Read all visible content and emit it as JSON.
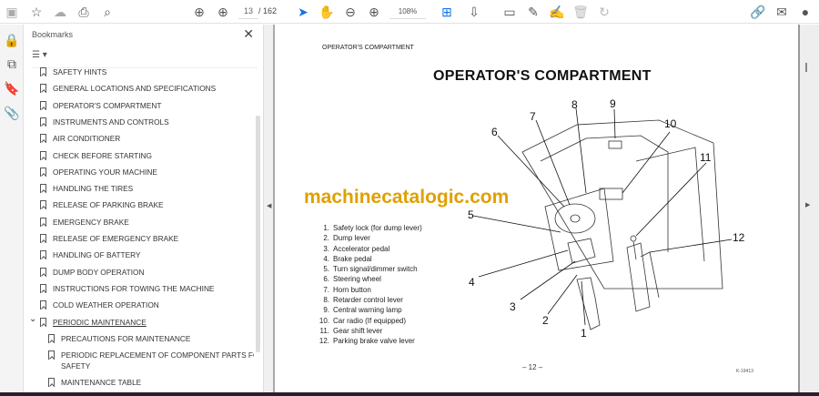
{
  "toolbar": {
    "current_page": "13",
    "total_pages": "/ 162",
    "zoom": "108%"
  },
  "bookmarks_panel": {
    "title": "Bookmarks",
    "close": "✕",
    "options": "☰ ▾",
    "items": [
      {
        "label": "SAFETY HINTS",
        "level": 0
      },
      {
        "label": "GENERAL LOCATIONS AND SPECIFICATIONS",
        "level": 0
      },
      {
        "label": "OPERATOR'S COMPARTMENT",
        "level": 0
      },
      {
        "label": "INSTRUMENTS AND CONTROLS",
        "level": 0
      },
      {
        "label": "AIR CONDITIONER",
        "level": 0
      },
      {
        "label": "CHECK BEFORE STARTING",
        "level": 0
      },
      {
        "label": "OPERATING YOUR MACHINE",
        "level": 0
      },
      {
        "label": "HANDLING THE TIRES",
        "level": 0
      },
      {
        "label": "RELEASE OF PARKING BRAKE",
        "level": 0
      },
      {
        "label": "EMERGENCY BRAKE",
        "level": 0
      },
      {
        "label": "RELEASE OF EMERGENCY BRAKE",
        "level": 0
      },
      {
        "label": "HANDLING OF BATTERY",
        "level": 0
      },
      {
        "label": "DUMP BODY OPERATION",
        "level": 0
      },
      {
        "label": "INSTRUCTIONS FOR TOWING THE MACHINE",
        "level": 0
      },
      {
        "label": "COLD WEATHER OPERATION",
        "level": 0
      },
      {
        "label": "PERIODIC MAINTENANCE",
        "level": 0
      },
      {
        "label": "PRECAUTIONS FOR MAINTENANCE",
        "level": 1
      },
      {
        "label": "PERIODIC REPLACEMENT OF COMPONENT PARTS FOR",
        "label2": "SAFETY",
        "level": 1
      },
      {
        "label": "MAINTENANCE TABLE",
        "level": 1
      }
    ]
  },
  "document": {
    "header": "OPERATOR'S COMPARTMENT",
    "title": "OPERATOR'S COMPARTMENT",
    "watermark": "machinecatalogic.com",
    "parts": [
      {
        "n": "1.",
        "t": "Safety lock (for dump lever)"
      },
      {
        "n": "2.",
        "t": "Dump lever"
      },
      {
        "n": "3.",
        "t": "Accelerator pedal"
      },
      {
        "n": "4.",
        "t": "Brake pedal"
      },
      {
        "n": "5.",
        "t": "Turn signal/dimmer switch"
      },
      {
        "n": "6.",
        "t": "Steering wheel"
      },
      {
        "n": "7.",
        "t": "Horn button"
      },
      {
        "n": "8.",
        "t": "Retarder control lever"
      },
      {
        "n": "9.",
        "t": "Central warning lamp"
      },
      {
        "n": "10.",
        "t": "Car radio (If equipped)"
      },
      {
        "n": "11.",
        "t": "Gear shift lever"
      },
      {
        "n": "12.",
        "t": "Parking brake valve lever"
      }
    ],
    "callouts": [
      "1",
      "2",
      "3",
      "4",
      "5",
      "6",
      "7",
      "8",
      "9",
      "10",
      "11",
      "12"
    ],
    "page_number": "– 12 –",
    "figure_code": "K-19413"
  },
  "colors": {
    "watermark": "#e0a000",
    "accent": "#1473e6"
  }
}
